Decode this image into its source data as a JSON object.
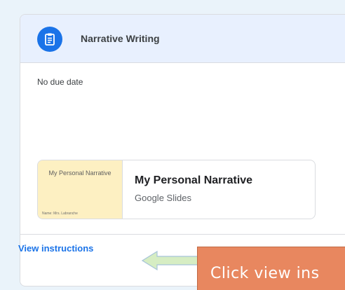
{
  "assignment": {
    "title": "Narrative Writing",
    "icon": "assignment-icon",
    "due_text": "No due date"
  },
  "attachment": {
    "thumbnail_title": "My Personal Narrative",
    "thumbnail_name": "Name: Mrs. Labranche",
    "title": "My Personal Narrative",
    "type": "Google Slides"
  },
  "footer": {
    "view_instructions_label": "View instructions"
  },
  "annotation": {
    "callout_text": "Click view ins"
  },
  "colors": {
    "accent": "#1a73e8",
    "header_bg": "#e8f0fe",
    "callout_bg": "#e8875f",
    "arrow_fill": "#d6edc3"
  }
}
